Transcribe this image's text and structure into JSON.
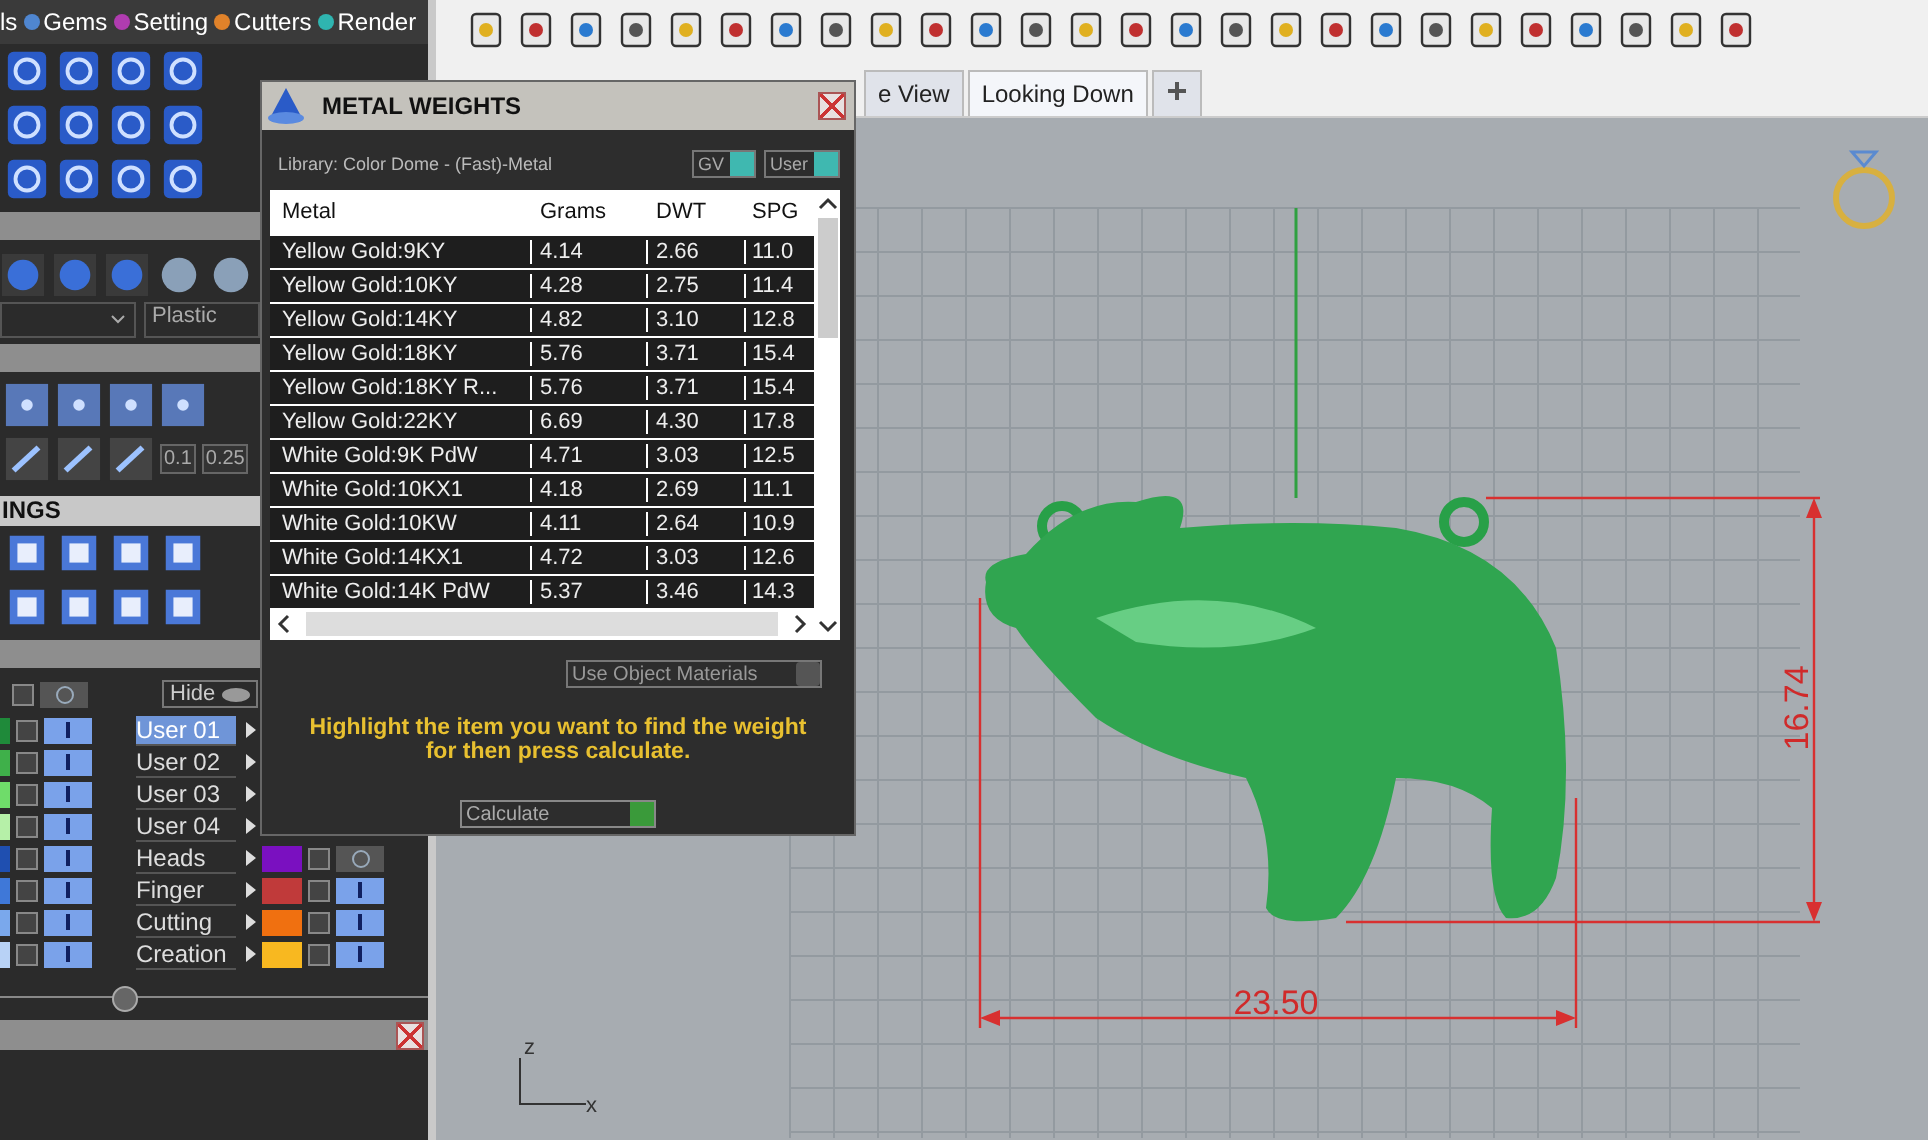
{
  "menu_tabs": [
    {
      "label": "ls"
    },
    {
      "label": "Gems",
      "color": "#4f86d0"
    },
    {
      "label": "Setting",
      "color": "#b03cb0"
    },
    {
      "label": "Cutters",
      "color": "#e0822a"
    },
    {
      "label": "Render",
      "color": "#2fb5b0"
    }
  ],
  "left_panel": {
    "material_dropdown": "Plastic",
    "fields": [
      "0.1",
      "0.25"
    ],
    "section_title": "INGS",
    "hide_label": "Hide",
    "column_1_header": {
      "visible": false
    },
    "column_1_layers": [
      {
        "color": "#1f8a3a",
        "visible": true
      },
      {
        "color": "#3fb04a",
        "visible": true
      },
      {
        "color": "#6fdc6a",
        "visible": true
      },
      {
        "color": "#b6f0a8",
        "visible": true
      },
      {
        "color": "#1f4fb0",
        "visible": true
      },
      {
        "color": "#3f78d8",
        "visible": true
      },
      {
        "color": "#7aa8ec",
        "visible": true
      },
      {
        "color": "#b8d2f6",
        "visible": true
      }
    ],
    "user_layers": [
      {
        "name": "User 01",
        "selected": true
      },
      {
        "name": "User 02",
        "selected": false
      },
      {
        "name": "User 03",
        "selected": false
      },
      {
        "name": "User 04",
        "selected": false
      }
    ],
    "layers": [
      {
        "name": "Heads",
        "color": "#7a10c0",
        "visible": false
      },
      {
        "name": "Finger",
        "color": "#c03a3a",
        "visible": true
      },
      {
        "name": "Cutting",
        "color": "#f07010",
        "visible": true
      },
      {
        "name": "Creation",
        "color": "#f8b820",
        "visible": true
      }
    ]
  },
  "view_tabs": [
    {
      "label": "e View",
      "selected": false
    },
    {
      "label": "Looking Down",
      "selected": true
    }
  ],
  "viewport": {
    "width_dimension": "23.50",
    "height_dimension": "16.74",
    "axes": [
      "z",
      "x"
    ]
  },
  "dialog": {
    "title": "METAL WEIGHTS",
    "library": "Library: Color Dome - (Fast)-Metal",
    "toggles": [
      {
        "label": "GV",
        "on": true
      },
      {
        "label": "User",
        "on": true
      }
    ],
    "table": {
      "columns": [
        "Metal",
        "Grams",
        "DWT",
        "SPG"
      ],
      "rows": [
        [
          "Yellow Gold:9KY",
          "4.14",
          "2.66",
          "11.0"
        ],
        [
          "Yellow Gold:10KY",
          "4.28",
          "2.75",
          "11.4"
        ],
        [
          "Yellow Gold:14KY",
          "4.82",
          "3.10",
          "12.8"
        ],
        [
          "Yellow Gold:18KY",
          "5.76",
          "3.71",
          "15.4"
        ],
        [
          "Yellow Gold:18KY R...",
          "5.76",
          "3.71",
          "15.4"
        ],
        [
          "Yellow Gold:22KY",
          "6.69",
          "4.30",
          "17.8"
        ],
        [
          "White Gold:9K PdW",
          "4.71",
          "3.03",
          "12.5"
        ],
        [
          "White Gold:10KX1",
          "4.18",
          "2.69",
          "11.1"
        ],
        [
          "White Gold:10KW",
          "4.11",
          "2.64",
          "10.9"
        ],
        [
          "White Gold:14KX1",
          "4.72",
          "3.03",
          "12.6"
        ],
        [
          "White Gold:14K PdW",
          "5.37",
          "3.46",
          "14.3"
        ]
      ]
    },
    "use_object_materials": {
      "label": "Use Object Materials",
      "checked": false
    },
    "hint": "Highlight the item you want to find the weight for then press calculate.",
    "calculate_button": "Calculate"
  }
}
